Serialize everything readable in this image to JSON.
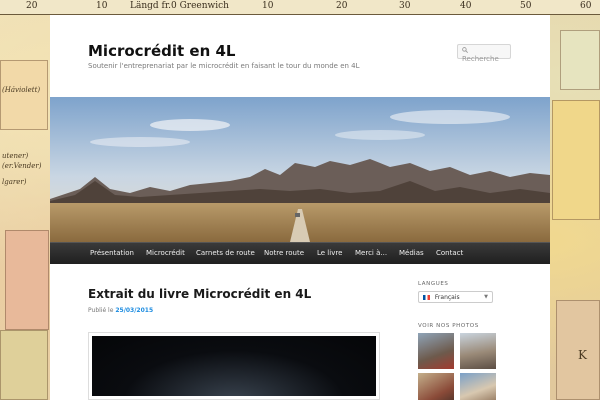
{
  "map": {
    "scale_labels": [
      "20",
      "10",
      "Längd fr.0 Greenwich",
      "10",
      "20",
      "30",
      "40",
      "50",
      "60"
    ],
    "labels": [
      "(Háviolett)",
      "utener)",
      "(er.Vender)",
      "lgarer)",
      "K"
    ]
  },
  "site": {
    "title": "Microcrédit en 4L",
    "description": "Soutenir l'entreprenariat par le microcrédit en faisant le tour du monde en 4L"
  },
  "search": {
    "placeholder": "Recherche",
    "icon": "search-icon"
  },
  "nav": {
    "items": [
      "Présentation",
      "Microcrédit",
      "Carnets de route",
      "Notre route",
      "Le livre",
      "Merci à...",
      "Médias",
      "Contact"
    ]
  },
  "article": {
    "title": "Extrait du livre Microcrédit en 4L",
    "meta_prefix": "Publié le",
    "date": "25/03/2015"
  },
  "sidebar": {
    "languages_heading": "LANGUES",
    "language_selected": "Français",
    "photos_heading": "VOIR NOS PHOTOS"
  },
  "colors": {
    "link": "#1b8be0",
    "nav_bg": "#222222",
    "title": "#111111"
  }
}
